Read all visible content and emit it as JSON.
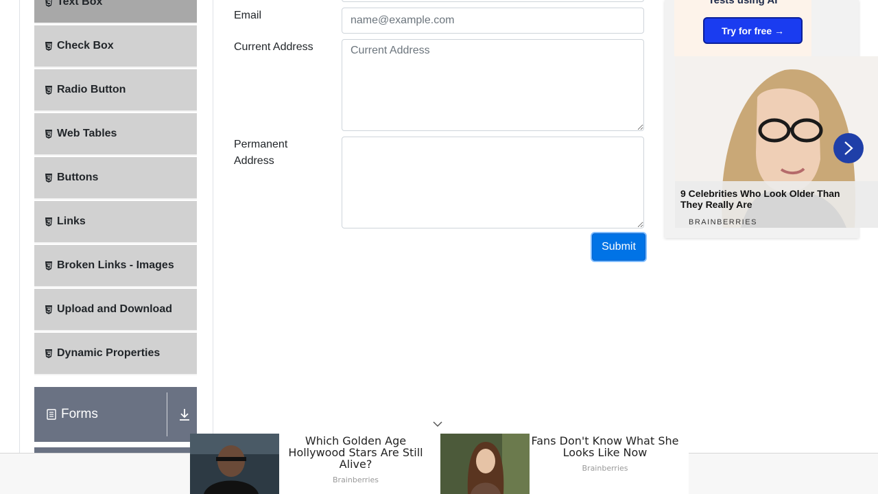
{
  "sidebar": {
    "items": [
      {
        "label": "Text Box",
        "icon": "html5-icon",
        "active": true
      },
      {
        "label": "Check Box",
        "icon": "html5-icon"
      },
      {
        "label": "Radio Button",
        "icon": "html5-icon"
      },
      {
        "label": "Web Tables",
        "icon": "html5-icon"
      },
      {
        "label": "Buttons",
        "icon": "html5-icon"
      },
      {
        "label": "Links",
        "icon": "html5-icon"
      },
      {
        "label": "Broken Links - Images",
        "icon": "html5-icon"
      },
      {
        "label": "Upload and Download",
        "icon": "html5-icon"
      },
      {
        "label": "Dynamic Properties",
        "icon": "html5-icon"
      }
    ],
    "forms_group": {
      "label": "Forms",
      "icon": "document-icon",
      "toggle_icon": "download-arrow-icon"
    }
  },
  "form": {
    "email_label": "Email",
    "email_placeholder": "name@example.com",
    "email_value": "",
    "current_address_label": "Current Address",
    "current_address_placeholder": "Current Address",
    "current_address_value": "",
    "permanent_address_label_line1": "Permanent",
    "permanent_address_label_line2": "Address",
    "permanent_address_value": "",
    "submit_label": "Submit"
  },
  "ads": {
    "right": {
      "top_text": "Tests using AI",
      "try_button": "Try for free →",
      "caption_title": "9 Celebrities Who Look Older Than They Really Are",
      "caption_brand": "BRAINBERRIES",
      "next_icon": "chevron-right-icon"
    },
    "bottom": {
      "item1_title": "Which Golden Age Hollywood Stars Are Still Alive?",
      "item1_brand": "Brainberries",
      "item2_title": "Fans Don't Know What She Looks Like Now",
      "item2_brand": "Brainberries",
      "collapse_icon": "chevron-down-icon"
    }
  },
  "colors": {
    "sidebar_item_bg": "#d1d1d1",
    "sidebar_active_bg": "#a8a8a8",
    "forms_group_bg": "#6a7283",
    "submit_bg": "#0073e6",
    "try_button_bg": "#1a3cf0"
  }
}
